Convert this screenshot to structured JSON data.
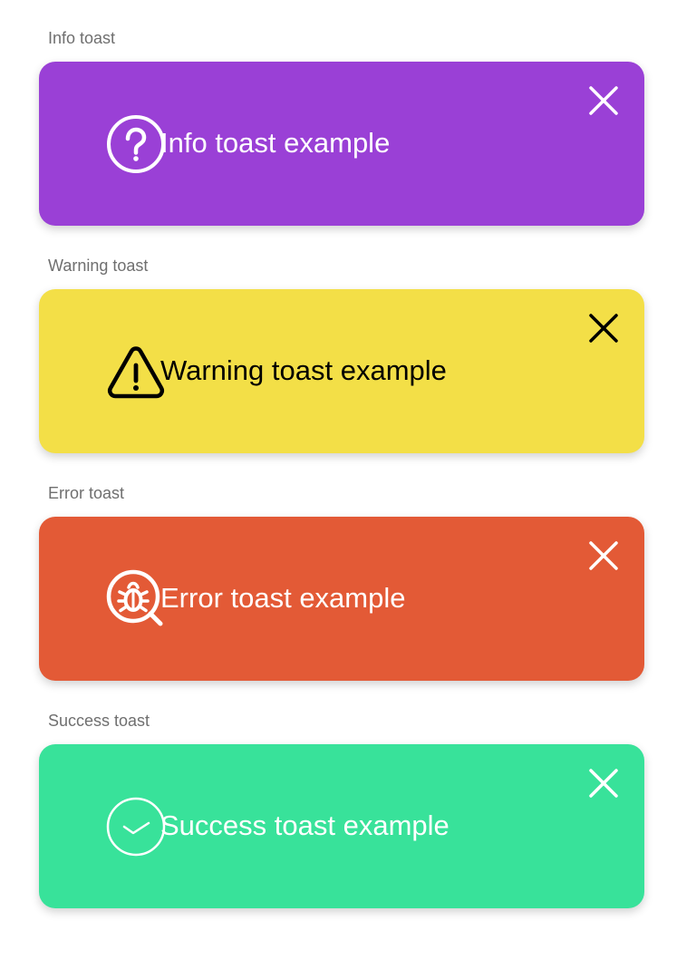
{
  "colors": {
    "info": "#9a40d6",
    "warning": "#f3df47",
    "error": "#e35a36",
    "success": "#38e29a",
    "label_text": "#6f6f6f"
  },
  "toasts": [
    {
      "section_label": "Info toast",
      "message": "Info toast example",
      "icon": "question-circle-icon",
      "close_icon": "close-icon",
      "variant": "info"
    },
    {
      "section_label": "Warning toast",
      "message": "Warning toast example",
      "icon": "warning-triangle-icon",
      "close_icon": "close-icon",
      "variant": "warning"
    },
    {
      "section_label": "Error toast",
      "message": "Error toast example",
      "icon": "bug-search-icon",
      "close_icon": "close-icon",
      "variant": "error"
    },
    {
      "section_label": "Success toast",
      "message": "Success toast example",
      "icon": "check-circle-icon",
      "close_icon": "close-icon",
      "variant": "success"
    }
  ]
}
